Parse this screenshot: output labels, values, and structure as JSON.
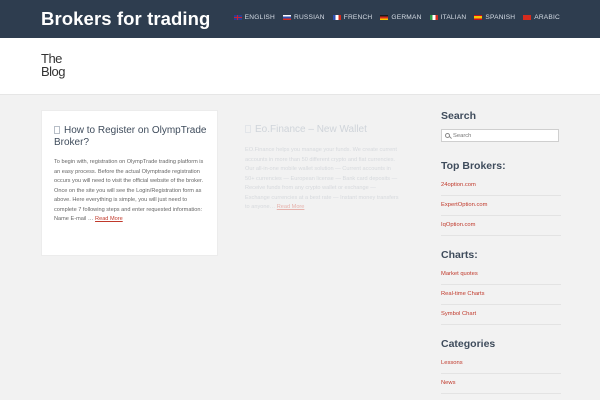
{
  "header": {
    "site_title": "Brokers for trading",
    "languages": [
      {
        "label": "English",
        "flag": "en"
      },
      {
        "label": "Russian",
        "flag": "ru"
      },
      {
        "label": "French",
        "flag": "fr"
      },
      {
        "label": "German",
        "flag": "de"
      },
      {
        "label": "Italian",
        "flag": "it"
      },
      {
        "label": "Spanish",
        "flag": "es"
      },
      {
        "label": "Arabic",
        "flag": "ar"
      }
    ]
  },
  "page": {
    "title_line1": "The",
    "title_line2": "Blog"
  },
  "posts": [
    {
      "title": "How to Register on OlympTrade Broker?",
      "excerpt": "To begin with, registration on OlympTrade trading platform is an easy process. Before the actual Olymptrade registration occurs you will need to visit the official website of the broker. Once on the site you will see the Login/Registration form as above. Here everything is simple, you will just need to complete 7 following steps and enter requested information: Name E-mail …",
      "read_more": "Read More"
    },
    {
      "title": "Eo.Finance – New Wallet",
      "excerpt": "EO.Finance helps you manage your funds. We create current accounts in more than 50 different crypto and fiat currencies. Our all-in-one mobile wallet solution — Current accounts in 50+ currencies — European license — Bank card deposits — Receive funds from any crypto wallet or exchange — Exchange currencies at a best rate — Instant money transfers to anyone…",
      "read_more": "Read More"
    }
  ],
  "sidebar": {
    "search": {
      "title": "Search",
      "placeholder": "Search"
    },
    "top_brokers": {
      "title": "Top Brokers:",
      "items": [
        "24option.com",
        "ExpertOption.com",
        "IqOption.com"
      ]
    },
    "charts": {
      "title": "Charts:",
      "items": [
        "Market quotes",
        "Real-time Charts",
        "Symbol Chart"
      ]
    },
    "categories": {
      "title": "Categories",
      "items": [
        "Lessons",
        "News"
      ]
    }
  },
  "colors": {
    "header_bg": "#2e3d4f",
    "link": "#c0392b",
    "page_bg": "#f2f2f2"
  }
}
